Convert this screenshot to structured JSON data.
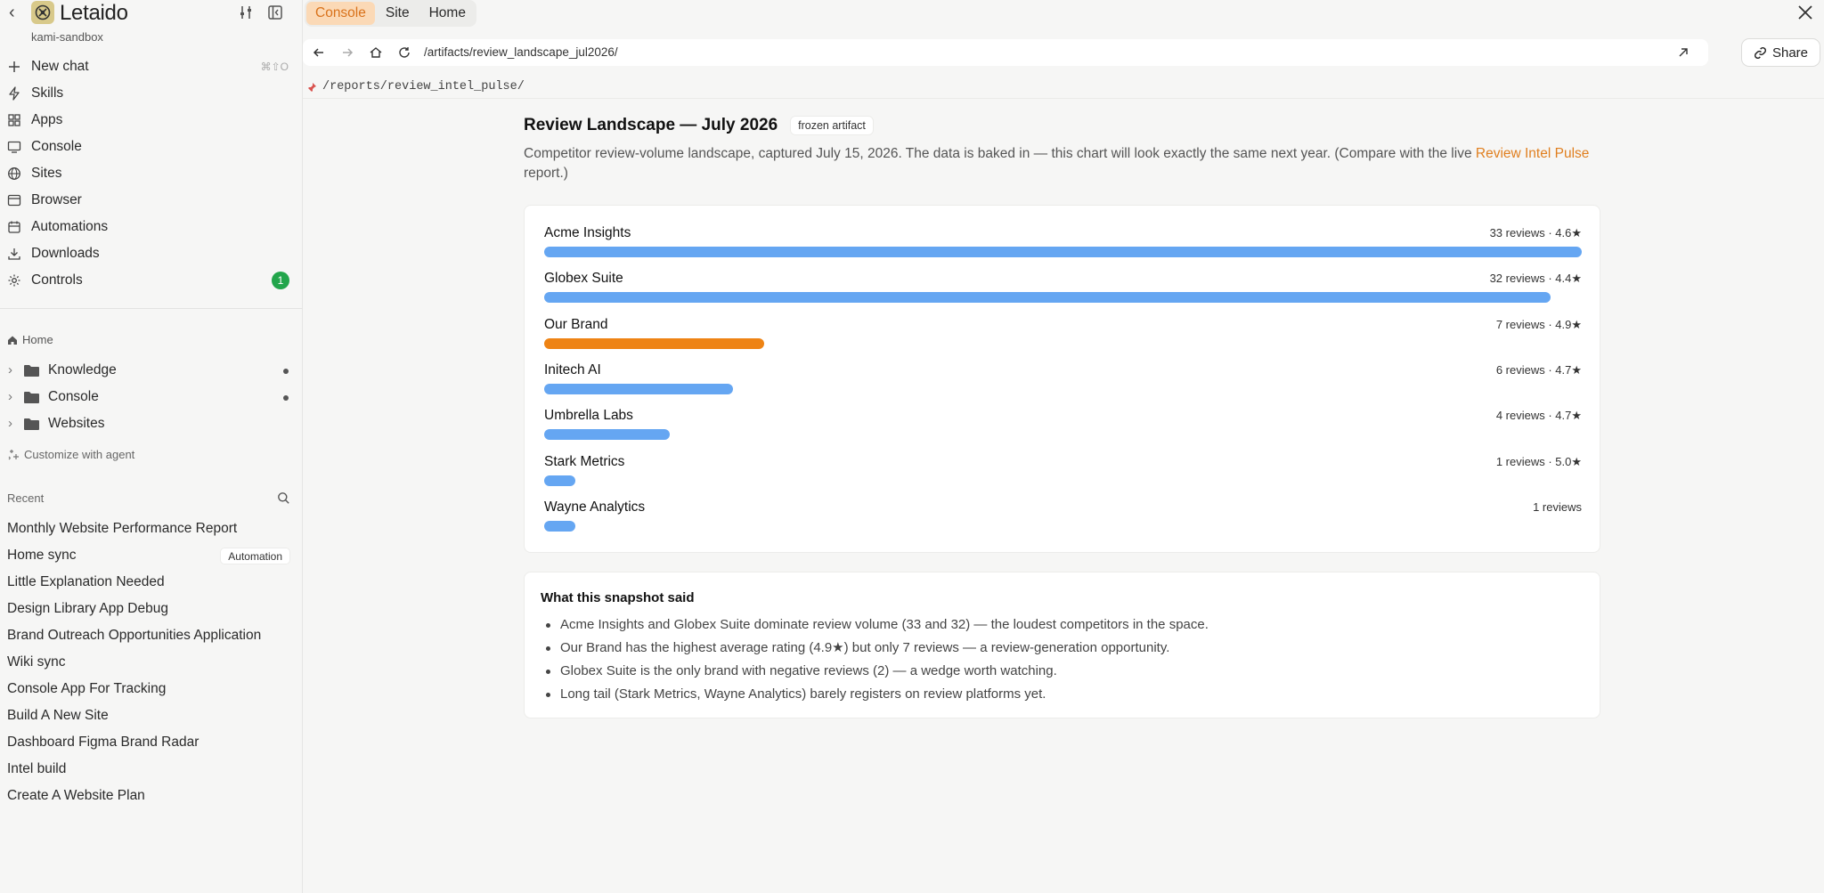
{
  "app": {
    "brand": "Letaido",
    "workspace": "kami-sandbox"
  },
  "nav": [
    {
      "label": "New chat",
      "icon": "plus-icon",
      "shortcut": "⌘⇧O"
    },
    {
      "label": "Skills",
      "icon": "bolt-icon"
    },
    {
      "label": "Apps",
      "icon": "grid-icon"
    },
    {
      "label": "Console",
      "icon": "monitor-icon"
    },
    {
      "label": "Sites",
      "icon": "globe-icon"
    },
    {
      "label": "Browser",
      "icon": "browser-icon"
    },
    {
      "label": "Automations",
      "icon": "calendar-icon"
    },
    {
      "label": "Downloads",
      "icon": "download-icon"
    },
    {
      "label": "Controls",
      "icon": "gear-icon",
      "badge": "1"
    }
  ],
  "tree": {
    "home_label": "Home",
    "items": [
      {
        "label": "Knowledge",
        "dot": true
      },
      {
        "label": "Console",
        "dot": true
      },
      {
        "label": "Websites",
        "dot": false
      }
    ],
    "customize_label": "Customize with agent"
  },
  "recent": {
    "heading": "Recent",
    "items": [
      {
        "label": "Monthly Website Performance Report"
      },
      {
        "label": "Home sync",
        "tag": "Automation"
      },
      {
        "label": "Little Explanation Needed"
      },
      {
        "label": "Design Library App Debug"
      },
      {
        "label": "Brand Outreach Opportunities Application"
      },
      {
        "label": "Wiki sync"
      },
      {
        "label": "Console App For Tracking"
      },
      {
        "label": "Build A New Site"
      },
      {
        "label": "Dashboard Figma Brand Radar"
      },
      {
        "label": "Intel build"
      },
      {
        "label": "Create A Website Plan"
      }
    ]
  },
  "tabs": [
    {
      "label": "Console",
      "active": true
    },
    {
      "label": "Site",
      "active": false
    },
    {
      "label": "Home",
      "active": false
    }
  ],
  "browser": {
    "url": "/artifacts/review_landscape_jul2026/",
    "share_label": "Share",
    "pinned_path": "/reports/review_intel_pulse/"
  },
  "page": {
    "title": "Review Landscape — July 2026",
    "badge": "frozen artifact",
    "desc_before": "Competitor review-volume landscape, captured July 15, 2026. The data is baked in — this chart will look exactly the same next year. (Compare with the live ",
    "desc_link": "Review Intel Pulse",
    "desc_after": " report.)"
  },
  "chart_data": {
    "type": "bar",
    "categories": [
      "Acme Insights",
      "Globex Suite",
      "Our Brand",
      "Initech AI",
      "Umbrella Labs",
      "Stark Metrics",
      "Wayne Analytics"
    ],
    "values": [
      33,
      32,
      7,
      6,
      4,
      1,
      1
    ],
    "meta_labels": [
      "33 reviews · 4.6★",
      "32 reviews · 4.4★",
      "7 reviews · 4.9★",
      "6 reviews · 4.7★",
      "4 reviews · 4.7★",
      "1 reviews · 5.0★",
      "1 reviews"
    ],
    "highlight": "Our Brand",
    "colors": {
      "default": "#65a6f2",
      "highlight": "#ee8314"
    }
  },
  "notes": {
    "title": "What this snapshot said",
    "items": [
      "Acme Insights and Globex Suite dominate review volume (33 and 32) — the loudest competitors in the space.",
      "Our Brand has the highest average rating (4.9★) but only 7 reviews — a review-generation opportunity.",
      "Globex Suite is the only brand with negative reviews (2) — a wedge worth watching.",
      "Long tail (Stark Metrics, Wayne Analytics) barely registers on review platforms yet."
    ]
  },
  "colors": {
    "accent": "#e07f1f",
    "active_tab_bg": "#fbd9b6",
    "badge_green": "#22a54b"
  }
}
